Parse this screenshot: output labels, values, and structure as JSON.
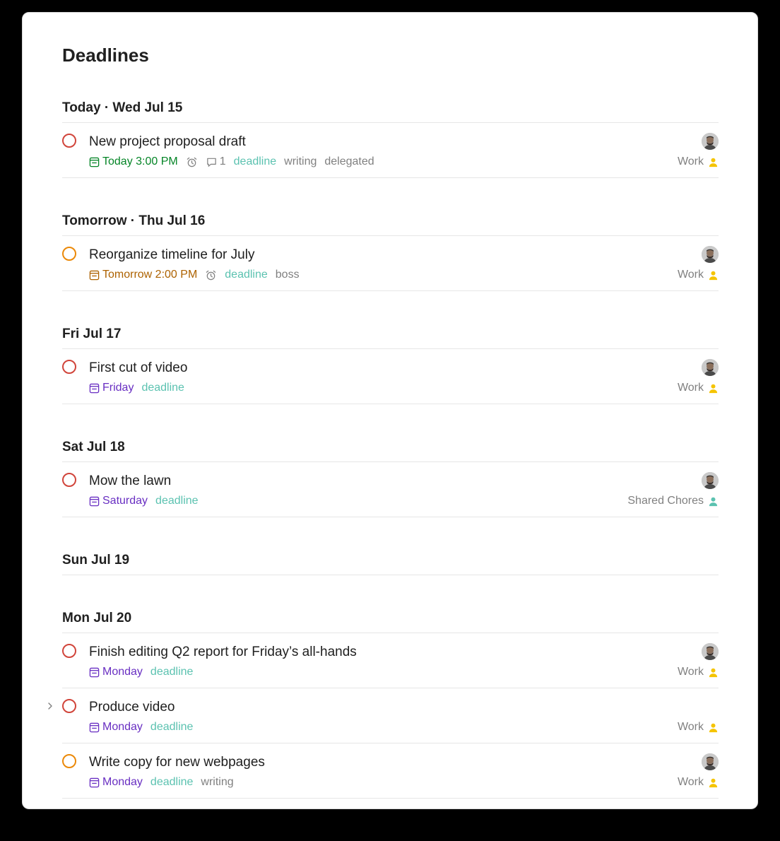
{
  "page": {
    "title": "Deadlines"
  },
  "colors": {
    "priority_1": "#d1453b",
    "priority_2": "#eb8909",
    "date_today": "#058527",
    "date_tomorrow": "#ad6200",
    "date_week": "#692fc2",
    "label_deadline": "#5bc2b0",
    "project_icon_work": "#f5c400",
    "project_icon_shared": "#5bc2b0"
  },
  "sections": [
    {
      "title": "Today · Wed Jul 15",
      "tasks": [
        {
          "title": "New project proposal draft",
          "priority": "p1",
          "due": "Today 3:00 PM",
          "due_style": "today",
          "reminder": true,
          "comments": "1",
          "labels": [
            "deadline",
            "writing",
            "delegated"
          ],
          "project": "Work",
          "project_icon": "work",
          "assignee": true
        }
      ]
    },
    {
      "title": "Tomorrow · Thu Jul 16",
      "tasks": [
        {
          "title": "Reorganize timeline for July",
          "priority": "p2",
          "due": "Tomorrow 2:00 PM",
          "due_style": "tomorrow",
          "reminder": true,
          "labels": [
            "deadline",
            "boss"
          ],
          "project": "Work",
          "project_icon": "work",
          "assignee": true
        }
      ]
    },
    {
      "title": "Fri Jul 17",
      "tasks": [
        {
          "title": "First cut of video",
          "priority": "p1",
          "due": "Friday",
          "due_style": "week",
          "labels": [
            "deadline"
          ],
          "project": "Work",
          "project_icon": "work",
          "assignee": true
        }
      ]
    },
    {
      "title": "Sat Jul 18",
      "tasks": [
        {
          "title": "Mow the lawn",
          "priority": "p1",
          "due": "Saturday",
          "due_style": "week",
          "labels": [
            "deadline"
          ],
          "project": "Shared Chores",
          "project_icon": "shared",
          "assignee": true
        }
      ]
    },
    {
      "title": "Sun Jul 19",
      "tasks": []
    },
    {
      "title": "Mon Jul 20",
      "tasks": [
        {
          "title": "Finish editing Q2 report for Friday’s all-hands",
          "priority": "p1",
          "due": "Monday",
          "due_style": "week",
          "labels": [
            "deadline"
          ],
          "project": "Work",
          "project_icon": "work",
          "assignee": true
        },
        {
          "title": "Produce video",
          "priority": "p1",
          "due": "Monday",
          "due_style": "week",
          "labels": [
            "deadline"
          ],
          "project": "Work",
          "project_icon": "work",
          "assignee": false,
          "has_subtasks": true
        },
        {
          "title": "Write copy for new webpages",
          "priority": "p2",
          "due": "Monday",
          "due_style": "week",
          "labels": [
            "deadline",
            "writing"
          ],
          "project": "Work",
          "project_icon": "work",
          "assignee": true
        }
      ]
    }
  ]
}
